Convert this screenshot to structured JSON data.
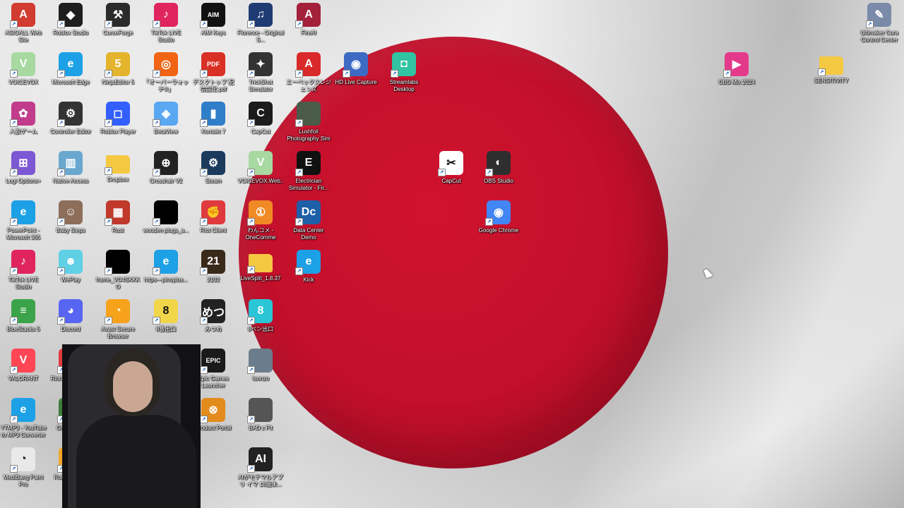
{
  "desktop": {
    "background": "Japan flag wallpaper",
    "colors": {
      "sun": "#c8102e",
      "field": "#e4e4e4"
    },
    "icons": [
      {
        "label": "ASIOALL Web Site",
        "icon": "asio-icon",
        "color": "#d23b2f",
        "glyph": "A"
      },
      {
        "label": "Roblox Studio",
        "icon": "roblox-studio-icon",
        "color": "#1e1e1e",
        "glyph": "◆"
      },
      {
        "label": "CurseForge",
        "icon": "curseforge-icon",
        "color": "#2b2b2b",
        "glyph": "⚒"
      },
      {
        "label": "TikTok LIVE Studio",
        "icon": "tiktok-live-icon",
        "color": "#e0245e",
        "glyph": "♪"
      },
      {
        "label": "AIM Keys",
        "icon": "aim-keys-icon",
        "color": "#111111",
        "glyph": "AIM"
      },
      {
        "label": "Florence - Original S...",
        "icon": "music-icon",
        "color": "#1f3b73",
        "glyph": "♫"
      },
      {
        "label": "FireAI",
        "icon": "fireai-icon",
        "color": "#a3213a",
        "glyph": "A"
      },
      {
        "label": "VOICEVOX",
        "icon": "voicevox-icon",
        "color": "#a7d9a1",
        "glyph": "V"
      },
      {
        "label": "Microsoft Edge",
        "icon": "edge-icon",
        "color": "#1da1e6",
        "glyph": "e"
      },
      {
        "label": "NinjaEditor 5",
        "icon": "ninja-editor-icon",
        "color": "#e3b42c",
        "glyph": "5"
      },
      {
        "label": "「オーバーウォッチ®」",
        "icon": "overwatch-icon",
        "color": "#f06414",
        "glyph": "◎"
      },
      {
        "label": "デスクトップ 配信設定.pdf",
        "icon": "pdf-icon",
        "color": "#d93025",
        "glyph": "PDF"
      },
      {
        "label": "TrickShot Simulator",
        "icon": "trickshot-icon",
        "color": "#333333",
        "glyph": "✦"
      },
      {
        "label": "エーペックスレジェンズ",
        "icon": "apex-icon",
        "color": "#da292a",
        "glyph": "A"
      },
      {
        "label": "HD Live Capture",
        "icon": "hd-live-capture-icon",
        "color": "#3d6bc4",
        "glyph": "◉"
      },
      {
        "label": "Streamlabs Desktop",
        "icon": "streamlabs-icon",
        "color": "#31c3a2",
        "glyph": "◘"
      },
      {
        "label": "OBS Mix 2024",
        "icon": "obs-mix-icon",
        "color": "#e43a8c",
        "glyph": "▶"
      },
      {
        "label": "SENSITIVITY",
        "icon": "folder-icon",
        "color": "#f5c842",
        "glyph": ""
      },
      {
        "label": "Ultimaker Cura Control Center",
        "icon": "cura-icon",
        "color": "#7a8aa8",
        "glyph": "✎"
      },
      {
        "label": "人狼ゲーム",
        "icon": "werewolf-icon",
        "color": "#c13c8a",
        "glyph": "✿"
      },
      {
        "label": "Controller Editor",
        "icon": "controller-editor-icon",
        "color": "#333333",
        "glyph": "⚙"
      },
      {
        "label": "Roblox Player",
        "icon": "roblox-player-icon",
        "color": "#335fff",
        "glyph": "◻"
      },
      {
        "label": "BetaView",
        "icon": "betaview-icon",
        "color": "#5aa7f2",
        "glyph": "◈"
      },
      {
        "label": "Kontakt 7",
        "icon": "kontakt-icon",
        "color": "#2f7ec9",
        "glyph": "▮"
      },
      {
        "label": "CapCut",
        "icon": "capcut-round-icon",
        "color": "#1c1c1c",
        "glyph": "C"
      },
      {
        "label": "Lushfoil Photography Sim",
        "icon": "lushfoil-icon",
        "color": "#4b5b4a",
        "glyph": ""
      },
      {
        "label": "Logi Options+",
        "icon": "logi-options-icon",
        "color": "#7d58d4",
        "glyph": "⊞"
      },
      {
        "label": "Native Access",
        "icon": "native-access-icon",
        "color": "#6aa7cf",
        "glyph": "▥"
      },
      {
        "label": "Dropbox",
        "icon": "folder-icon",
        "color": "#f5c842",
        "glyph": ""
      },
      {
        "label": "Crosshair V2",
        "icon": "crosshair-icon",
        "color": "#222222",
        "glyph": "⊕"
      },
      {
        "label": "Steam",
        "icon": "steam-icon",
        "color": "#1b3a5c",
        "glyph": "⚙"
      },
      {
        "label": "VOICEVOX.Web...",
        "icon": "voicevox-web-icon",
        "color": "#a7d9a1",
        "glyph": "V"
      },
      {
        "label": "Electrician Simulator - Fir...",
        "icon": "electrician-sim-icon",
        "color": "#111111",
        "glyph": "E"
      },
      {
        "label": "CapCut",
        "icon": "capcut-icon",
        "color": "#ffffff",
        "glyph": "✂"
      },
      {
        "label": "OBS Studio",
        "icon": "obs-studio-icon",
        "color": "#2e2e2e",
        "glyph": "◐"
      },
      {
        "label": "PowerPoint - Microsoft 365",
        "icon": "edge-icon",
        "color": "#1da1e6",
        "glyph": "e"
      },
      {
        "label": "Baby Steps",
        "icon": "baby-steps-icon",
        "color": "#8d6e5a",
        "glyph": "☺"
      },
      {
        "label": "Rust",
        "icon": "rust-icon",
        "color": "#c0392b",
        "glyph": "▦"
      },
      {
        "label": "wooden plugs_a...",
        "icon": "image-file-icon",
        "color": "#000000",
        "glyph": ""
      },
      {
        "label": "Riot Client",
        "icon": "riot-client-icon",
        "color": "#e03a3e",
        "glyph": "✊"
      },
      {
        "label": "わんコメ - OneComme",
        "icon": "onecomme-icon",
        "color": "#f08a24",
        "glyph": "①"
      },
      {
        "label": "Data Center Demo",
        "icon": "data-center-icon",
        "color": "#1e5fa8",
        "glyph": "Dc"
      },
      {
        "label": "Google Chrome",
        "icon": "chrome-icon",
        "color": "#4285f4",
        "glyph": "◉"
      },
      {
        "label": "TikTok LIVE Studio",
        "icon": "tiktok-live-icon",
        "color": "#e0245e",
        "glyph": "♪"
      },
      {
        "label": "WePlay",
        "icon": "weplay-icon",
        "color": "#5fd0e6",
        "glyph": "☻"
      },
      {
        "label": "frame_VO4SKKKO",
        "icon": "image-file-icon",
        "color": "#000000",
        "glyph": ""
      },
      {
        "label": "https---pinoplus...",
        "icon": "edge-icon",
        "color": "#1da1e6",
        "glyph": "e"
      },
      {
        "label": "2102",
        "icon": "game-2102-icon",
        "color": "#3a2a1a",
        "glyph": "21"
      },
      {
        "label": "LiveSplit_1.8.37",
        "icon": "folder-icon",
        "color": "#f5c842",
        "glyph": ""
      },
      {
        "label": "Kick",
        "icon": "edge-icon",
        "color": "#1da1e6",
        "glyph": "e"
      },
      {
        "label": "BlueStacks 5",
        "icon": "bluestacks-icon",
        "color": "#3ba34a",
        "glyph": "≡"
      },
      {
        "label": "Discord",
        "icon": "discord-icon",
        "color": "#5865f2",
        "glyph": "◕"
      },
      {
        "label": "Avast Secure Browser",
        "icon": "avast-browser-icon",
        "color": "#f7a21b",
        "glyph": "◔"
      },
      {
        "label": "8番出口",
        "icon": "exit8-icon",
        "color": "#f1d64a",
        "glyph": "8"
      },
      {
        "label": "みつめ",
        "icon": "mitsume-icon",
        "color": "#222222",
        "glyph": "めつ"
      },
      {
        "label": "8ペン出口",
        "icon": "exit8-pen-icon",
        "color": "#2ac6d6",
        "glyph": "8"
      },
      {
        "label": "VALORANT",
        "icon": "valorant-icon",
        "color": "#ff4655",
        "glyph": "V"
      },
      {
        "label": "Riot ダイレクト",
        "icon": "riot-client-icon",
        "color": "#e03a3e",
        "glyph": "✊"
      },
      {
        "label": "Epic Games Launcher",
        "icon": "epic-games-icon",
        "color": "#1a1a1a",
        "glyph": "EPIC"
      },
      {
        "label": "Isonzo",
        "icon": "isonzo-icon",
        "color": "#6b7c8c",
        "glyph": ""
      },
      {
        "label": "YTMP3 - YouTube to MP3 Converter",
        "icon": "edge-icon",
        "color": "#1da1e6",
        "glyph": "e"
      },
      {
        "label": "Grand Th...",
        "icon": "gta-icon",
        "color": "#3f7d3a",
        "glyph": "V"
      },
      {
        "label": "Product Portal",
        "icon": "product-portal-icon",
        "color": "#e38b1c",
        "glyph": "⊗"
      },
      {
        "label": "BAD ε Pit",
        "icon": "bad-pit-icon",
        "color": "#555555",
        "glyph": ""
      },
      {
        "label": "MediBang Paint Pro",
        "icon": "medibang-icon",
        "color": "#e9e9e9",
        "glyph": "◔"
      },
      {
        "label": "Rocket Lea...",
        "icon": "rocket-league-icon",
        "color": "#f1a92a",
        "glyph": ""
      },
      {
        "label": "AIがモテマルアプリ イマ 18歳未...",
        "icon": "ai-app-icon",
        "color": "#222222",
        "glyph": "AI"
      }
    ]
  }
}
